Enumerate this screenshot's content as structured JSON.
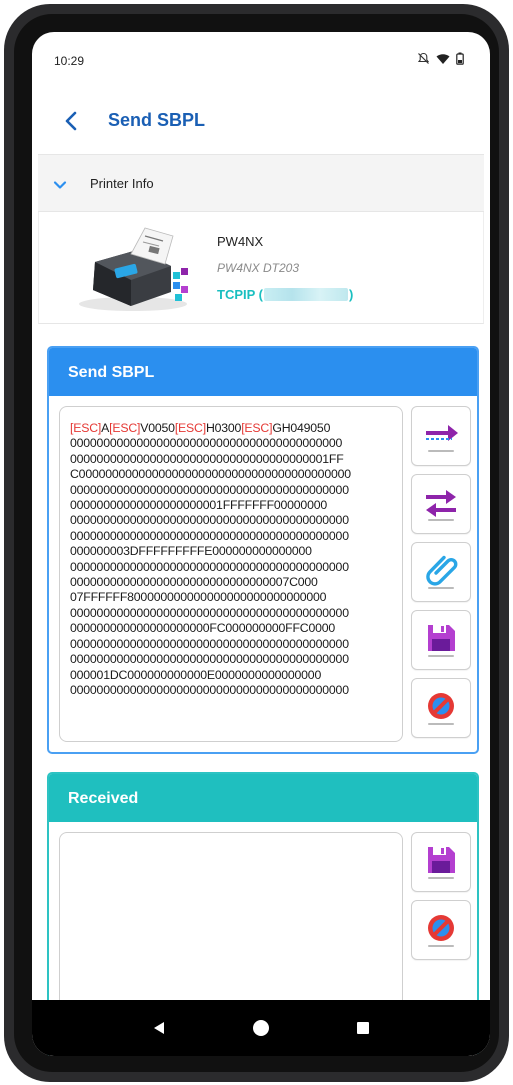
{
  "status_bar": {
    "time": "10:29"
  },
  "header": {
    "title": "Send SBPL"
  },
  "printer_info": {
    "section_label": "Printer Info",
    "model": "PW4NX",
    "model_detail": "PW4NX DT203",
    "connection_prefix": "TCPIP (",
    "connection_suffix": ")"
  },
  "send_panel": {
    "title": "Send SBPL",
    "first_line": [
      {
        "text": "[ESC]",
        "esc": true
      },
      {
        "text": "A",
        "esc": false
      },
      {
        "text": "[ESC]",
        "esc": true
      },
      {
        "text": "V0050",
        "esc": false
      },
      {
        "text": "[ESC]",
        "esc": true
      },
      {
        "text": "H0300",
        "esc": false
      },
      {
        "text": "[ESC]",
        "esc": true
      },
      {
        "text": "GH049050",
        "esc": false
      }
    ],
    "lines": [
      "00000000000000000000000000000000000000000",
      "000000000000000000000000000000000000001FF",
      "C00000000000000000000000000000000000000000",
      "000000000000000000000000000000000000000000",
      "00000000000000000000001FFFFFFF00000000",
      "000000000000000000000000000000000000000000",
      "000000000000000000000000000000000000000000",
      "000000003DFFFFFFFFFE000000000000000",
      "000000000000000000000000000000000000000000",
      "000000000000000000000000000000007C000",
      "07FFFFFF800000000000000000000000000000",
      "000000000000000000000000000000000000000000",
      "000000000000000000000FC000000000FFC0000",
      "000000000000000000000000000000000000000000",
      "000000000000000000000000000000000000000000",
      "000001DC000000000000E0000000000000000",
      "000000000000000000000000000000000000000000"
    ],
    "buttons": [
      "send-arrow-icon",
      "send-receive-icon",
      "attach-icon",
      "save-icon",
      "clear-icon"
    ]
  },
  "received_panel": {
    "title": "Received",
    "content": "",
    "buttons": [
      "save-icon",
      "clear-icon"
    ]
  },
  "colors": {
    "accent_blue": "#2b8fef",
    "accent_teal": "#1fbfbf",
    "title_blue": "#1a5fb4",
    "connection_teal": "#19bfc0",
    "esc_red": "#e53935",
    "icon_purple": "#8e24aa"
  }
}
